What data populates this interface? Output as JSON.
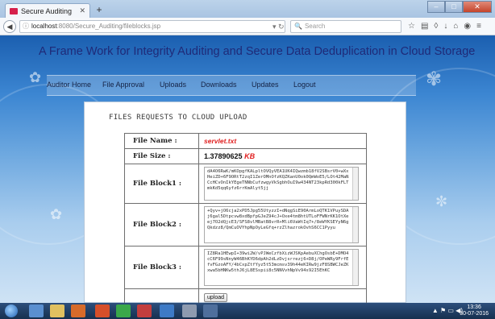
{
  "browser": {
    "tab_title": "Secure Auditing",
    "url_host": "localhost",
    "url_path": ":8080/Secure_Auditing/fileblocks.jsp",
    "search_placeholder": "Search"
  },
  "page": {
    "title": "A Frame Work for Integrity Auditing and Secure Data Deduplication in Cloud Storage",
    "menu": [
      {
        "label": "Auditor Home"
      },
      {
        "label": "File Approval"
      },
      {
        "label": "Uploads"
      },
      {
        "label": "Downloads"
      },
      {
        "label": "Updates"
      },
      {
        "label": "Logout"
      }
    ],
    "section_title": "FILES REQUESTS TO CLOUD UPLOAD",
    "file": {
      "name_label": "File Name   :",
      "name_value": "servlet.txt",
      "size_label": "File Size   :",
      "size_value": "1.37890625",
      "size_unit": "KB",
      "block1_label": "File Block1 :",
      "block1_text": "dA4O6RwK/mKOpgfKALpltOVQyVEA1UK4IQwzmb18fV2SBsrV0+wXxHeiZD+6F9ORtT2zqI1ZerOMnOfzKQZKanU0ok0QmWoE5/LOt42MaNCcHCvOnIkYEgeTNNbCufzwgyVkSgbhOuI9w434NT23kpRd300kFLTmkKd5qq6yfz6rrKmAlyt5jj",
      "block2_label": "File Block2 :",
      "block2_text": "+Qyv+jO6cja2xPD5Jpg55UtyzzI+dNqgSiE90ArmLoQTK1VPuySDAj6gal5Dtpcvw8xdBpfpGJeZ94cJ+Oxe4tm8htUTLoFFWNrKK1OtXeej7O2dQjcE3/SFS8vlMBatB8vrR+Mli6VaWtIq7+/8eWYKSEYyN6gQkdzz8/QmCuOVYhpNpOyLeGfq+rzZlhazrokOvhS6CC1Pyyu",
      "block3_label": "File Block3 :",
      "block3_text": "IZ8Ra1HEwpI+39wi2W/vPJWeCzfbXizWJSKpAebuXChgOsbE+DMO4cC6F99sNnyW46BhKYD6dpAh2dLzDvjsrrezj6+D8j/OPeWRy9FrfEfvFGzoAFY/4bCxpZtfYyz5t53mcmsv39h44eKIRw9jzF8SBWCJeZKxwa5bHNKw5thJ6jL8ESspii8c5NNVvhNpVv94s92I5EhKC",
      "upload_label": "upload"
    }
  },
  "taskbar": {
    "time": "13:36",
    "date": "30-07-2016"
  },
  "colors": {
    "accent_red": "#e01f1f",
    "title_blue": "#1f2a78"
  }
}
